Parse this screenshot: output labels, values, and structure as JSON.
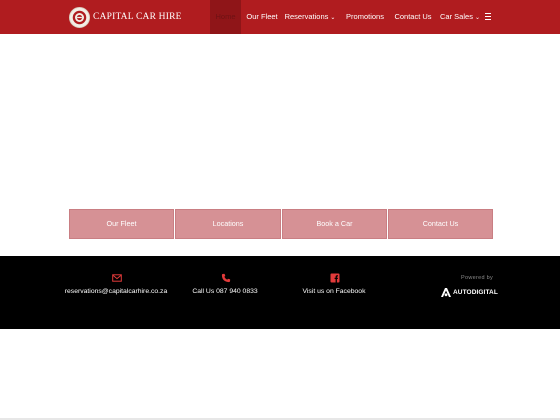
{
  "header": {
    "brand_name": "CAPITAL CAR HIRE",
    "nav": [
      {
        "label": "Home"
      },
      {
        "label": "Our Fleet"
      },
      {
        "label": "Reservations",
        "caret": "⌄"
      },
      {
        "label": "Promotions"
      },
      {
        "label": "Contact Us"
      },
      {
        "label": "Car Sales",
        "caret": "⌄"
      }
    ],
    "menu_icon": "hamburger-icon"
  },
  "quick_links": [
    {
      "label": "Our Fleet"
    },
    {
      "label": "Locations"
    },
    {
      "label": "Book a Car"
    },
    {
      "label": "Contact Us"
    }
  ],
  "footer": {
    "email": {
      "icon": "envelope-icon",
      "text": "reservations@capitalcarhire.co.za"
    },
    "phone": {
      "icon": "phone-icon",
      "text": "Call Us 087 940 0833"
    },
    "facebook": {
      "icon": "facebook-icon",
      "text": "Visit us on Facebook"
    },
    "powered_by": "Powered by",
    "powered_brand": "AUTODIGITAL"
  },
  "colors": {
    "header_bg": "#b01c1f",
    "accent_red": "#e23a3a",
    "button_bg": "#d69195",
    "footer_bg": "#000000"
  }
}
